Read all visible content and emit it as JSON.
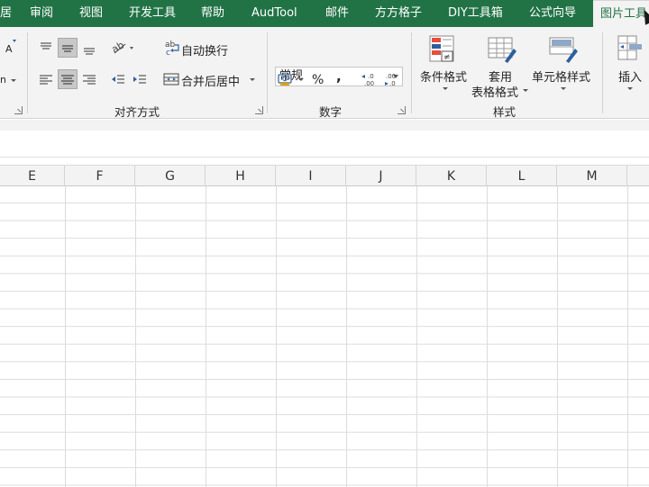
{
  "tabs": [
    "居",
    "审阅",
    "视图",
    "开发工具",
    "帮助",
    "AudTool",
    "邮件",
    "方方格子",
    "DIY工具箱",
    "公式向导",
    "图片工具"
  ],
  "ribbon": {
    "wrap_text": "自动换行",
    "merge_center": "合并后居中",
    "alignment_group": "对齐方式",
    "number_format": "常规",
    "percent": "%",
    "comma": ",",
    "number_group": "数字",
    "cond_format": "条件格式",
    "table_format_1": "套用",
    "table_format_2": "表格格式",
    "cell_styles": "单元格样式",
    "styles_group": "样式",
    "insert": "插入",
    "font_small_a": "A",
    "font_n": "n"
  },
  "columns": [
    "E",
    "F",
    "G",
    "H",
    "I",
    "J",
    "K",
    "L",
    "M"
  ],
  "colors": {
    "accent": "#217346",
    "ribbon_bg": "#f3f3f3",
    "grid_line": "#dcdcdc"
  }
}
